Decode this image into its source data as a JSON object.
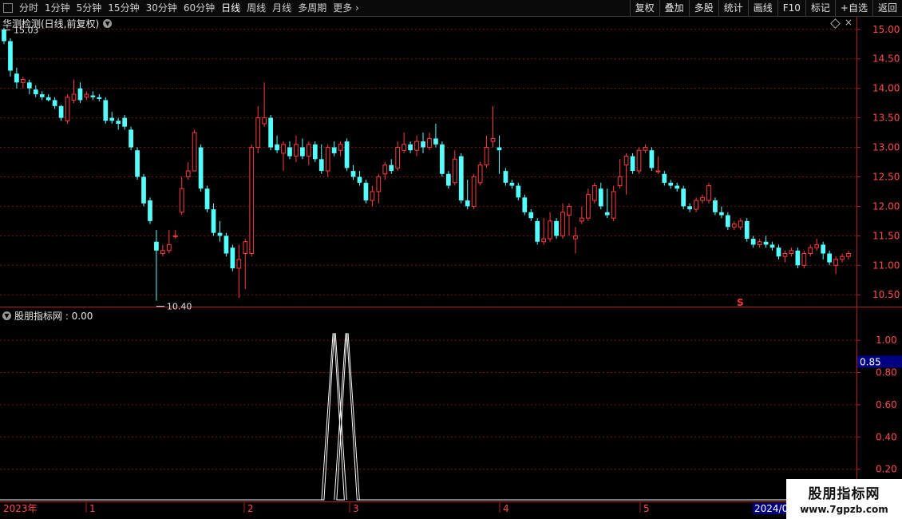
{
  "toolbar": {
    "items": [
      "分时",
      "1分钟",
      "5分钟",
      "15分钟",
      "30分钟",
      "60分钟",
      "日线",
      "周线",
      "月线",
      "多周期",
      "更多"
    ],
    "more_arrow": "›",
    "right": [
      "复权",
      "叠加",
      "多股",
      "统计",
      "画线",
      "F10",
      "标记",
      "+自选",
      "返回"
    ]
  },
  "main": {
    "title": "华测检测(日线,前复权)",
    "close_glyph": "×",
    "high_label": "15.03",
    "low_label": "10.40",
    "s_marker": "S",
    "y_ticks": [
      "15.00",
      "14.50",
      "14.00",
      "13.50",
      "13.00",
      "12.50",
      "12.00",
      "11.50",
      "11.00",
      "10.50"
    ]
  },
  "sub": {
    "title": "股朋指标网 : 0.00",
    "y_ticks": [
      "1.00",
      "0.80",
      "0.60",
      "0.40",
      "0.20"
    ],
    "cursor_value": "0.85"
  },
  "xaxis": {
    "start_label": "2023年",
    "month_labels": [
      "1",
      "2",
      "3",
      "4",
      "5"
    ],
    "end_label": "2024/0"
  },
  "watermark": {
    "line1": "股朋指标网",
    "line2": "www.7gpzb.com"
  },
  "colors": {
    "up": "#ff3b3b",
    "down": "#54ffff",
    "grid": "#7a1414",
    "axis": "#b01e1e",
    "ma": "#ffffff"
  },
  "chart_data": {
    "type": "candlestick",
    "ylim": [
      10.3,
      15.2
    ],
    "candles": [
      [
        15.0,
        14.8,
        15.03,
        14.75
      ],
      [
        14.8,
        14.3,
        14.85,
        14.2
      ],
      [
        14.25,
        14.1,
        14.35,
        14.0
      ],
      [
        14.1,
        14.15,
        14.2,
        14.0
      ],
      [
        14.1,
        14.0,
        14.15,
        13.9
      ],
      [
        13.98,
        13.9,
        14.05,
        13.85
      ],
      [
        13.9,
        13.85,
        13.95,
        13.8
      ],
      [
        13.85,
        13.8,
        13.9,
        13.78
      ],
      [
        13.8,
        13.7,
        13.85,
        13.65
      ],
      [
        13.7,
        13.5,
        13.72,
        13.45
      ],
      [
        13.45,
        13.85,
        13.9,
        13.4
      ],
      [
        13.8,
        13.9,
        14.15,
        13.75
      ],
      [
        14.0,
        13.8,
        14.1,
        13.75
      ],
      [
        13.85,
        13.9,
        13.95,
        13.8
      ],
      [
        13.88,
        13.85,
        13.95,
        13.8
      ],
      [
        13.85,
        13.82,
        13.9,
        13.78
      ],
      [
        13.8,
        13.45,
        13.85,
        13.4
      ],
      [
        13.5,
        13.45,
        13.6,
        13.4
      ],
      [
        13.45,
        13.4,
        13.5,
        13.3
      ],
      [
        13.5,
        13.35,
        13.55,
        13.3
      ],
      [
        13.3,
        13.0,
        13.35,
        12.95
      ],
      [
        12.95,
        12.5,
        13.0,
        12.45
      ],
      [
        12.5,
        12.05,
        12.55,
        12.0
      ],
      [
        12.1,
        11.75,
        12.15,
        11.7
      ],
      [
        11.4,
        11.25,
        11.6,
        10.4
      ],
      [
        11.2,
        11.25,
        11.35,
        11.15
      ],
      [
        11.25,
        11.35,
        11.6,
        11.2
      ],
      [
        11.5,
        11.5,
        11.6,
        11.45
      ],
      [
        11.9,
        12.3,
        12.5,
        11.85
      ],
      [
        12.5,
        12.6,
        12.75,
        12.45
      ],
      [
        12.6,
        13.25,
        13.3,
        12.6
      ],
      [
        13.0,
        12.3,
        13.05,
        12.25
      ],
      [
        12.3,
        11.95,
        12.35,
        11.9
      ],
      [
        11.95,
        11.55,
        12.05,
        11.5
      ],
      [
        11.55,
        11.5,
        11.75,
        11.4
      ],
      [
        11.5,
        11.2,
        11.55,
        11.15
      ],
      [
        11.3,
        10.95,
        11.35,
        10.9
      ],
      [
        10.95,
        11.1,
        11.35,
        10.45
      ],
      [
        11.2,
        11.4,
        11.45,
        10.6
      ],
      [
        11.2,
        13.0,
        13.05,
        11.15
      ],
      [
        13.0,
        13.5,
        13.7,
        12.9
      ],
      [
        13.4,
        13.5,
        14.1,
        13.35
      ],
      [
        13.5,
        13.0,
        13.55,
        12.95
      ],
      [
        13.05,
        12.95,
        13.2,
        12.9
      ],
      [
        12.9,
        13.05,
        13.1,
        12.6
      ],
      [
        13.0,
        12.85,
        13.1,
        12.8
      ],
      [
        12.85,
        13.05,
        13.2,
        12.75
      ],
      [
        13.0,
        12.85,
        13.15,
        12.8
      ],
      [
        12.85,
        13.05,
        13.1,
        12.7
      ],
      [
        13.05,
        12.8,
        13.1,
        12.75
      ],
      [
        12.8,
        12.6,
        13.05,
        12.55
      ],
      [
        12.6,
        13.0,
        13.05,
        12.5
      ],
      [
        13.0,
        12.9,
        13.1,
        12.85
      ],
      [
        12.95,
        13.05,
        13.1,
        12.85
      ],
      [
        13.1,
        12.65,
        13.15,
        12.6
      ],
      [
        12.6,
        12.5,
        12.7,
        12.45
      ],
      [
        12.5,
        12.4,
        12.6,
        12.35
      ],
      [
        12.4,
        12.1,
        12.45,
        12.05
      ],
      [
        12.1,
        12.25,
        12.35,
        12.0
      ],
      [
        12.25,
        12.5,
        12.55,
        12.05
      ],
      [
        12.55,
        12.7,
        12.75,
        12.45
      ],
      [
        12.7,
        12.6,
        12.8,
        12.55
      ],
      [
        12.65,
        13.0,
        13.1,
        12.6
      ],
      [
        12.95,
        13.05,
        13.25,
        12.9
      ],
      [
        13.05,
        12.95,
        13.1,
        12.9
      ],
      [
        12.95,
        13.1,
        13.2,
        12.85
      ],
      [
        13.1,
        13.0,
        13.25,
        12.9
      ],
      [
        13.0,
        13.15,
        13.25,
        12.95
      ],
      [
        13.15,
        13.05,
        13.4,
        13.0
      ],
      [
        13.05,
        12.55,
        13.1,
        12.5
      ],
      [
        12.55,
        12.35,
        12.6,
        12.3
      ],
      [
        12.4,
        12.8,
        12.95,
        12.35
      ],
      [
        12.85,
        12.1,
        12.9,
        12.05
      ],
      [
        12.1,
        12.0,
        12.45,
        11.95
      ],
      [
        12.0,
        12.5,
        12.55,
        11.95
      ],
      [
        12.4,
        12.7,
        12.75,
        12.35
      ],
      [
        12.7,
        13.0,
        13.2,
        12.65
      ],
      [
        13.1,
        13.15,
        13.7,
        13.0
      ],
      [
        13.0,
        12.95,
        13.2,
        12.55
      ],
      [
        12.6,
        12.4,
        12.65,
        12.35
      ],
      [
        12.4,
        12.35,
        12.45,
        12.3
      ],
      [
        12.35,
        12.15,
        12.4,
        12.1
      ],
      [
        12.15,
        11.9,
        12.2,
        11.85
      ],
      [
        11.9,
        11.8,
        11.95,
        11.75
      ],
      [
        11.75,
        11.4,
        11.8,
        11.35
      ],
      [
        11.4,
        11.45,
        11.8,
        11.35
      ],
      [
        11.45,
        11.75,
        11.9,
        11.4
      ],
      [
        11.75,
        11.5,
        11.8,
        11.45
      ],
      [
        11.5,
        11.9,
        12.05,
        11.45
      ],
      [
        11.85,
        12.0,
        12.05,
        11.5
      ],
      [
        11.45,
        11.5,
        11.65,
        11.2
      ],
      [
        11.75,
        11.8,
        12.0,
        11.7
      ],
      [
        11.8,
        12.2,
        12.3,
        11.75
      ],
      [
        12.1,
        12.35,
        12.4,
        12.05
      ],
      [
        12.3,
        12.0,
        12.4,
        11.95
      ],
      [
        11.9,
        11.85,
        12.3,
        11.8
      ],
      [
        11.8,
        12.25,
        12.35,
        11.75
      ],
      [
        12.35,
        12.5,
        12.8,
        12.3
      ],
      [
        12.7,
        12.85,
        12.9,
        12.2
      ],
      [
        12.85,
        12.6,
        12.9,
        12.55
      ],
      [
        12.6,
        12.95,
        13.0,
        12.55
      ],
      [
        12.95,
        13.0,
        13.05,
        12.9
      ],
      [
        12.95,
        12.65,
        13.0,
        12.6
      ],
      [
        12.6,
        12.6,
        12.85,
        12.55
      ],
      [
        12.55,
        12.4,
        12.6,
        12.35
      ],
      [
        12.4,
        12.35,
        12.45,
        12.3
      ],
      [
        12.35,
        12.3,
        12.4,
        12.25
      ],
      [
        12.3,
        12.0,
        12.35,
        11.95
      ],
      [
        12.0,
        11.95,
        12.05,
        11.9
      ],
      [
        11.95,
        12.1,
        12.15,
        11.9
      ],
      [
        12.1,
        12.15,
        12.2,
        12.05
      ],
      [
        12.1,
        12.35,
        12.4,
        12.05
      ],
      [
        12.1,
        11.9,
        12.15,
        11.85
      ],
      [
        11.9,
        11.85,
        12.0,
        11.8
      ],
      [
        11.85,
        11.65,
        11.9,
        11.6
      ],
      [
        11.65,
        11.7,
        11.75,
        11.6
      ],
      [
        11.65,
        11.75,
        11.8,
        11.6
      ],
      [
        11.75,
        11.45,
        11.8,
        11.4
      ],
      [
        11.45,
        11.35,
        11.5,
        11.3
      ],
      [
        11.35,
        11.4,
        11.45,
        11.3
      ],
      [
        11.4,
        11.35,
        11.5,
        11.3
      ],
      [
        11.35,
        11.3,
        11.4,
        11.25
      ],
      [
        11.3,
        11.15,
        11.35,
        11.1
      ],
      [
        11.15,
        11.2,
        11.25,
        11.05
      ],
      [
        11.2,
        11.25,
        11.3,
        11.15
      ],
      [
        11.25,
        11.0,
        11.3,
        10.95
      ],
      [
        11.0,
        11.2,
        11.25,
        10.95
      ],
      [
        11.2,
        11.3,
        11.35,
        11.15
      ],
      [
        11.3,
        11.35,
        11.45,
        11.25
      ],
      [
        11.35,
        11.2,
        11.4,
        11.1
      ],
      [
        11.2,
        11.05,
        11.25,
        11.0
      ],
      [
        11.0,
        11.1,
        11.15,
        10.85
      ],
      [
        11.1,
        11.15,
        11.2,
        11.05
      ],
      [
        11.15,
        11.2,
        11.25,
        11.1
      ]
    ],
    "sub_indicator": {
      "name": "股朋指标网",
      "ylim": [
        0,
        1.1
      ],
      "spike_indices": [
        52,
        54
      ]
    }
  }
}
